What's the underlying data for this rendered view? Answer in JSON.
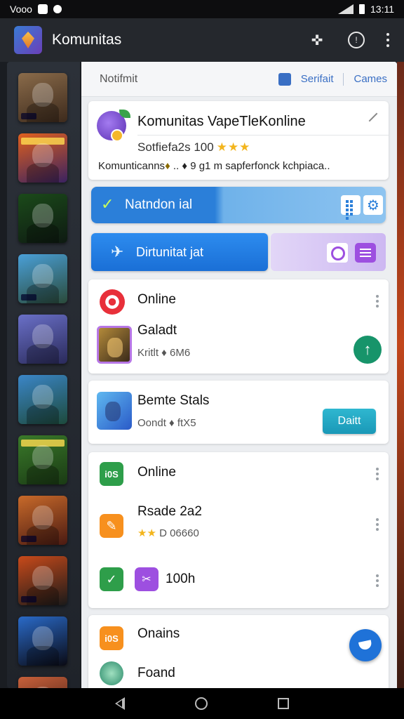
{
  "status_bar": {
    "left_text": "Vooo",
    "time": "13:11"
  },
  "app_bar": {
    "title": "Komunitas"
  },
  "rail": {
    "items": [
      {
        "colors": [
          "#8a6b4a",
          "#3d2a1c"
        ],
        "banner": false,
        "tag": true
      },
      {
        "colors": [
          "#e0601e",
          "#3a2260"
        ],
        "banner": true,
        "tag": false
      },
      {
        "colors": [
          "#1b4a1a",
          "#0e1a12"
        ],
        "banner": false,
        "tag": false
      },
      {
        "colors": [
          "#4aa0d8",
          "#2a4a3a"
        ],
        "banner": false,
        "tag": true
      },
      {
        "colors": [
          "#6a70c8",
          "#2a2a5a"
        ],
        "banner": false,
        "tag": false
      },
      {
        "colors": [
          "#3b86c8",
          "#1d4a3c"
        ],
        "banner": false,
        "tag": false
      },
      {
        "colors": [
          "#3a7a2a",
          "#1a3a14"
        ],
        "banner": true,
        "tag": false
      },
      {
        "colors": [
          "#c86a2a",
          "#4a1a12"
        ],
        "banner": false,
        "tag": true
      },
      {
        "colors": [
          "#c84a1a",
          "#1a1a1a"
        ],
        "banner": false,
        "tag": true
      },
      {
        "colors": [
          "#2a6ac8",
          "#0a0a14"
        ],
        "banner": false,
        "tag": false
      },
      {
        "colors": [
          "#c8603a",
          "#3a1a14"
        ],
        "banner": false,
        "tag": false
      }
    ]
  },
  "tabs": {
    "notif_label": "Notifmit",
    "link1": "Serifait",
    "link2": "Cames"
  },
  "header_card": {
    "title": "Komunitas VapeTleKonline",
    "subtitle": "Sotfiefa2s 100",
    "stars": "★★★",
    "desc_prefix": "Komunticanns",
    "desc_rest": " .. ♦ 9 g1 m sapferfonck kchpiaca.."
  },
  "banner_blue": {
    "label": "Natndon ial"
  },
  "banner_dist": {
    "label": "Dirtunitat jat"
  },
  "online_card_1": {
    "title": "Online",
    "game_title": "Galadt",
    "game_sub": "Kritlt ♦ 6M6"
  },
  "semte_card": {
    "title": "Bemte Stals",
    "sub": "Oondt ♦ ftX5",
    "button_label": "Daitt"
  },
  "online_card_2": {
    "badge_label": "i0S",
    "title": "Online",
    "row1_title": "Rsade 2a2",
    "row1_sub": "D 06660",
    "row2_title": "100h"
  },
  "onains_card": {
    "badge_label": "i0S",
    "title": "Onains",
    "row_title": "Foand"
  },
  "colors": {
    "accent_blue": "#2b7fd9",
    "accent_purple": "#9d4fe0",
    "accent_green": "#17946a",
    "accent_teal": "#1a98b7"
  }
}
